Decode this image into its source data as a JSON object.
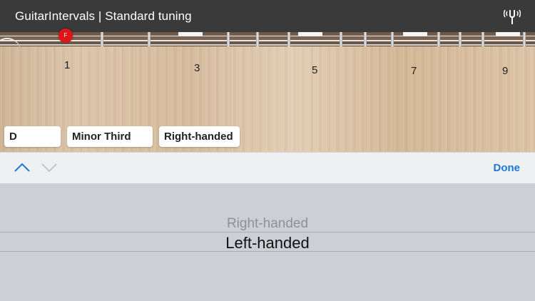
{
  "header": {
    "title": "GuitarIntervals | Standard tuning",
    "tuner_icon": "tuning-fork-icon"
  },
  "fretboard": {
    "note_marker": "F",
    "fret_numbers": [
      "1",
      "3",
      "5",
      "7",
      "9"
    ]
  },
  "selectors": {
    "note": "D",
    "interval": "Minor Third",
    "handedness": "Right-handed"
  },
  "toolbar": {
    "prev_icon": "chevron-up-icon",
    "next_icon": "chevron-down-icon",
    "done_label": "Done",
    "accent_color": "#1c78d6"
  },
  "picker": {
    "options": [
      "Right-handed",
      "Left-handed"
    ],
    "selected": "Left-handed"
  }
}
